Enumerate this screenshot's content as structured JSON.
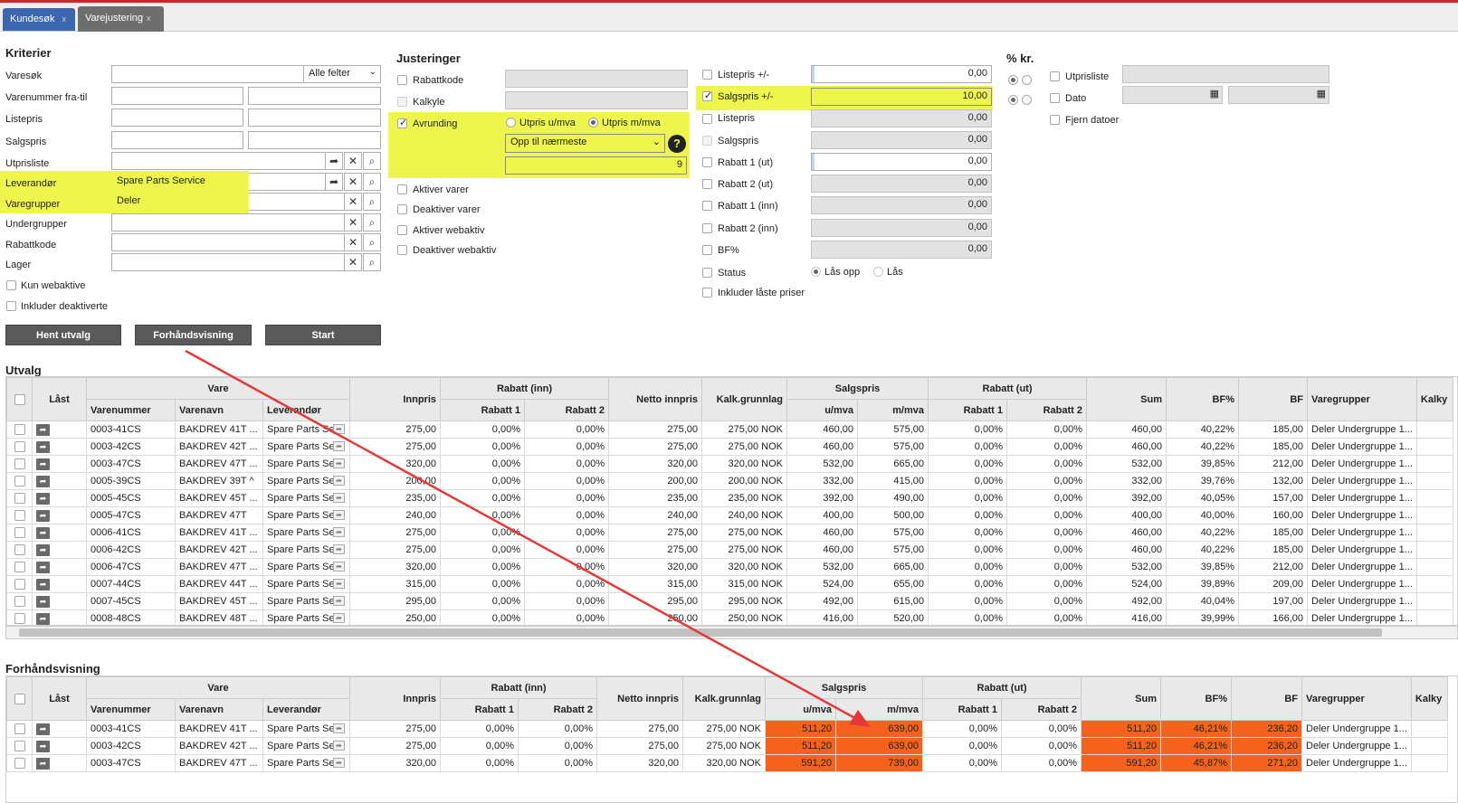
{
  "tabs": [
    {
      "label": "Kundesøk",
      "close": "x"
    },
    {
      "label": "Varejustering",
      "close": "x"
    }
  ],
  "criteria": {
    "title": "Kriterier",
    "varesok_label": "Varesøk",
    "varesok_value": "",
    "varesok_select": "Alle felter",
    "varenummer_label": "Varenummer fra-til",
    "listepris_label": "Listepris",
    "salgspris_label": "Salgspris",
    "utprisliste_label": "Utprisliste",
    "leverandor_label": "Leverandør",
    "leverandor_value": "Spare Parts Service",
    "varegrupper_label": "Varegrupper",
    "varegrupper_value": "Deler",
    "undergrupper_label": "Undergrupper",
    "rabattkode_label": "Rabattkode",
    "lager_label": "Lager",
    "kun_webaktive": "Kun webaktive",
    "inkluder_deaktiverte": "Inkluder deaktiverte"
  },
  "buttons": {
    "hent": "Hent utvalg",
    "forhands": "Forhåndsvisning",
    "start": "Start"
  },
  "adjust": {
    "title": "Justeringer",
    "rabattkode": "Rabattkode",
    "kalkyle": "Kalkyle",
    "avrunding": "Avrunding",
    "utpris_umva": "Utpris u/mva",
    "utpris_mmva": "Utpris m/mva",
    "rounding_select": "Opp til nærmeste",
    "rounding_value": "9",
    "help": "?",
    "aktiver": "Aktiver varer",
    "deaktiver": "Deaktiver varer",
    "aktiver_web": "Aktiver webaktiv",
    "deaktiver_web": "Deaktiver webaktiv"
  },
  "prices": {
    "listepris_pm": "Listepris +/-",
    "listepris_pm_val": "0,00",
    "salgspris_pm": "Salgspris +/-",
    "salgspris_pm_val": "10,00",
    "listepris": "Listepris",
    "listepris_val": "0,00",
    "salgspris": "Salgspris",
    "salgspris_val": "0,00",
    "rabatt1ut": "Rabatt 1 (ut)",
    "rabatt1ut_val": "0,00",
    "rabatt2ut": "Rabatt 2 (ut)",
    "rabatt2ut_val": "0,00",
    "rabatt1inn": "Rabatt 1 (inn)",
    "rabatt1inn_val": "0,00",
    "rabatt2inn": "Rabatt 2 (inn)",
    "rabatt2inn_val": "0,00",
    "bf": "BF%",
    "bf_val": "0,00",
    "status": "Status",
    "las_opp": "Lås opp",
    "las": "Lås",
    "inkl_laste": "Inkluder låste priser"
  },
  "pct": {
    "title": "% kr.",
    "utprisliste": "Utprisliste",
    "dato": "Dato",
    "fjern": "Fjern datoer"
  },
  "utvalg": {
    "title": "Utvalg",
    "headers": {
      "last": "Låst",
      "vare": "Vare",
      "varenummer": "Varenummer",
      "varenavn": "Varenavn",
      "leverandor": "Leverandør",
      "innpris": "Innpris",
      "rabatt_inn": "Rabatt (inn)",
      "rabatt1": "Rabatt 1",
      "rabatt2": "Rabatt 2",
      "netto": "Netto innpris",
      "kalk": "Kalk.grunnlag",
      "salgspris": "Salgspris",
      "umva": "u/mva",
      "mmva": "m/mva",
      "rabatt_ut": "Rabatt (ut)",
      "sum": "Sum",
      "bfp": "BF%",
      "bf": "BF",
      "varegrupper": "Varegrupper",
      "kalky": "Kalky"
    },
    "rows": [
      [
        "0003-41CS",
        "BAKDREV 41T ...",
        "Spare Parts Se",
        "275,00",
        "0,00%",
        "0,00%",
        "275,00",
        "275,00 NOK",
        "460,00",
        "575,00",
        "0,00%",
        "0,00%",
        "460,00",
        "40,22%",
        "185,00",
        "Deler Undergruppe 1..."
      ],
      [
        "0003-42CS",
        "BAKDREV 42T ...",
        "Spare Parts Se",
        "275,00",
        "0,00%",
        "0,00%",
        "275,00",
        "275,00 NOK",
        "460,00",
        "575,00",
        "0,00%",
        "0,00%",
        "460,00",
        "40,22%",
        "185,00",
        "Deler Undergruppe 1..."
      ],
      [
        "0003-47CS",
        "BAKDREV 47T ...",
        "Spare Parts Se",
        "320,00",
        "0,00%",
        "0,00%",
        "320,00",
        "320,00 NOK",
        "532,00",
        "665,00",
        "0,00%",
        "0,00%",
        "532,00",
        "39,85%",
        "212,00",
        "Deler Undergruppe 1..."
      ],
      [
        "0005-39CS",
        "BAKDREV 39T ^",
        "Spare Parts Se",
        "200,00",
        "0,00%",
        "0,00%",
        "200,00",
        "200,00 NOK",
        "332,00",
        "415,00",
        "0,00%",
        "0,00%",
        "332,00",
        "39,76%",
        "132,00",
        "Deler Undergruppe 1..."
      ],
      [
        "0005-45CS",
        "BAKDREV 45T ...",
        "Spare Parts Se",
        "235,00",
        "0,00%",
        "0,00%",
        "235,00",
        "235,00 NOK",
        "392,00",
        "490,00",
        "0,00%",
        "0,00%",
        "392,00",
        "40,05%",
        "157,00",
        "Deler Undergruppe 1..."
      ],
      [
        "0005-47CS",
        "BAKDREV 47T",
        "Spare Parts Se",
        "240,00",
        "0,00%",
        "0,00%",
        "240,00",
        "240,00 NOK",
        "400,00",
        "500,00",
        "0,00%",
        "0,00%",
        "400,00",
        "40,00%",
        "160,00",
        "Deler Undergruppe 1..."
      ],
      [
        "0006-41CS",
        "BAKDREV 41T ...",
        "Spare Parts Se",
        "275,00",
        "0,00%",
        "0,00%",
        "275,00",
        "275,00 NOK",
        "460,00",
        "575,00",
        "0,00%",
        "0,00%",
        "460,00",
        "40,22%",
        "185,00",
        "Deler Undergruppe 1..."
      ],
      [
        "0006-42CS",
        "BAKDREV 42T ...",
        "Spare Parts Se",
        "275,00",
        "0,00%",
        "0,00%",
        "275,00",
        "275,00 NOK",
        "460,00",
        "575,00",
        "0,00%",
        "0,00%",
        "460,00",
        "40,22%",
        "185,00",
        "Deler Undergruppe 1..."
      ],
      [
        "0006-47CS",
        "BAKDREV 47T ...",
        "Spare Parts Se",
        "320,00",
        "0,00%",
        "0,00%",
        "320,00",
        "320,00 NOK",
        "532,00",
        "665,00",
        "0,00%",
        "0,00%",
        "532,00",
        "39,85%",
        "212,00",
        "Deler Undergruppe 1..."
      ],
      [
        "0007-44CS",
        "BAKDREV 44T ...",
        "Spare Parts Se",
        "315,00",
        "0,00%",
        "0,00%",
        "315,00",
        "315,00 NOK",
        "524,00",
        "655,00",
        "0,00%",
        "0,00%",
        "524,00",
        "39,89%",
        "209,00",
        "Deler Undergruppe 1..."
      ],
      [
        "0007-45CS",
        "BAKDREV 45T ...",
        "Spare Parts Se",
        "295,00",
        "0,00%",
        "0,00%",
        "295,00",
        "295,00 NOK",
        "492,00",
        "615,00",
        "0,00%",
        "0,00%",
        "492,00",
        "40,04%",
        "197,00",
        "Deler Undergruppe 1..."
      ],
      [
        "0008-48CS",
        "BAKDREV 48T ...",
        "Spare Parts Se",
        "250,00",
        "0,00%",
        "0,00%",
        "250,00",
        "250,00 NOK",
        "416,00",
        "520,00",
        "0,00%",
        "0,00%",
        "416,00",
        "39,99%",
        "166,00",
        "Deler Undergruppe 1..."
      ]
    ]
  },
  "preview": {
    "title": "Forhåndsvisning",
    "rows": [
      [
        "0003-41CS",
        "BAKDREV 41T ...",
        "Spare Parts Se",
        "275,00",
        "0,00%",
        "0,00%",
        "275,00",
        "275,00 NOK",
        "511,20",
        "639,00",
        "0,00%",
        "0,00%",
        "511,20",
        "46,21%",
        "236,20",
        "Deler Undergruppe 1..."
      ],
      [
        "0003-42CS",
        "BAKDREV 42T ...",
        "Spare Parts Se",
        "275,00",
        "0,00%",
        "0,00%",
        "275,00",
        "275,00 NOK",
        "511,20",
        "639,00",
        "0,00%",
        "0,00%",
        "511,20",
        "46,21%",
        "236,20",
        "Deler Undergruppe 1..."
      ],
      [
        "0003-47CS",
        "BAKDREV 47T ...",
        "Spare Parts Se",
        "320,00",
        "0,00%",
        "0,00%",
        "320,00",
        "320,00 NOK",
        "591,20",
        "739,00",
        "0,00%",
        "0,00%",
        "591,20",
        "45,87%",
        "271,20",
        "Deler Undergruppe 1..."
      ]
    ]
  },
  "colors": {
    "tab_active": "#3c66ad",
    "tab_inactive": "#6e6e6e",
    "highlight": "#eef64d",
    "changed": "#f5621e",
    "arrow": "#e23a3a",
    "topline": "#c8262b"
  }
}
